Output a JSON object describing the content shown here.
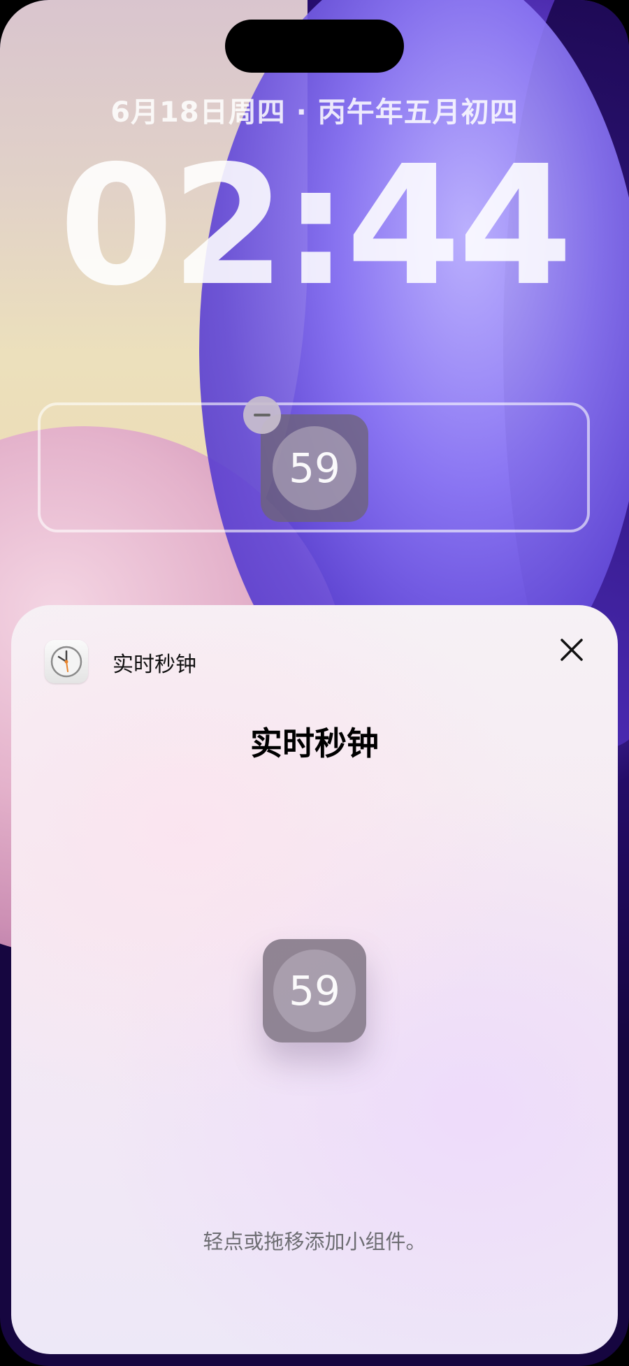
{
  "lockscreen": {
    "date": "6月18日周四 · 丙午年五月初四",
    "time": "02:44"
  },
  "widget": {
    "seconds": "59"
  },
  "sheet": {
    "app_name": "实时秒钟",
    "title": "实时秒钟",
    "preview_seconds": "59",
    "hint": "轻点或拖移添加小组件。"
  },
  "icons": {
    "remove": "minus-icon",
    "close": "close-icon",
    "app": "clock-icon"
  }
}
